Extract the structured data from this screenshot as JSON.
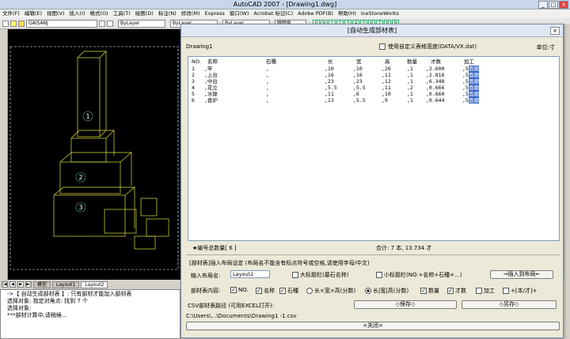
{
  "app": {
    "title": "AutoCAD 2007 - [Drawing1.dwg]"
  },
  "menu": [
    "文件(F)",
    "编辑(E)",
    "视图(V)",
    "插入(I)",
    "格式(O)",
    "工具(T)",
    "绘图(D)",
    "标注(N)",
    "修改(M)",
    "Express",
    "窗口(W)",
    "Acrobat 标记(C)",
    "Adobe PDF(B)",
    "帮助(H)",
    "IceStoneWorks"
  ],
  "toolbar": {
    "layer": "GAISANJ",
    "linetype1": "ByLayer",
    "linetype2": "ByLayer",
    "linetype3": "ByLayer",
    "color": "随颜色",
    "number_buttons": [
      "6",
      "N",
      "1",
      "2",
      "3",
      "4",
      "5",
      "6",
      "7",
      "8",
      "9"
    ]
  },
  "tabs": [
    "模型",
    "Layout1",
    "Layout2"
  ],
  "command_lines": [
    "->【 自动生成部材表 】: 只有部材才能加入部材表",
    "选择对象: 指定对角点: 找到 7 个",
    "选择对象:",
    "***部材计算中,请稍候..."
  ],
  "drawing_labels": [
    "1",
    "2",
    "3"
  ],
  "dialog": {
    "title": "[自动生成部材表]",
    "drawing_name": "Drawing1",
    "custom_table_label": "使用自定义表格宽度(DATA/VX.dat)",
    "unit": "单位:寸",
    "columns": [
      "NO.",
      "名称",
      "石種",
      "长",
      "宽",
      "高",
      "数量",
      "才数",
      "加工"
    ],
    "rows": [
      [
        "1",
        ",竿",
        ",",
        ",10",
        ",10",
        ",26",
        ",1",
        ",2.600",
        ",5"
      ],
      [
        "2",
        ",上台",
        ",",
        ",16",
        ",16",
        ",11",
        ",1",
        ",2.816",
        ",5"
      ],
      [
        "3",
        ",中台",
        ",",
        ",23",
        ",23",
        ",12",
        ",1",
        ",6.348",
        ",5"
      ],
      [
        "4",
        ",花立",
        ",",
        ",5.5",
        ",5.5",
        ",11",
        ",2",
        ",0.666",
        ",5"
      ],
      [
        "5",
        ",水鉢",
        ",",
        ",11",
        ",6",
        ",10",
        ",1",
        ",0.660",
        ",5"
      ],
      [
        "6",
        ",香炉",
        ",",
        ",13",
        ",5.5",
        ",9",
        ",1",
        ",0.644",
        ",5"
      ]
    ],
    "gong_marks": [
      "面磨",
      "面磨",
      "面磨",
      "面磨",
      "面磨",
      "面磨"
    ],
    "total_count": "★编号总数量[ 6 ]",
    "total_sum": "合计: 7 本, 13.734 才",
    "layout_section_title": "[部材表]插入布局设定 (布局名不能含有标点符号或空格,请使用字母/中文)",
    "layout_label": "输入布局名:",
    "layout_value": "Layout2",
    "big_header": "大标题栏(墓石名称)",
    "small_header": "小标题栏(NO.+名称+石種+...)",
    "insert_button": "→插入到布局←",
    "content_label": "部材表内容:",
    "options": [
      "NO.",
      "名称",
      "石種",
      "长×宽×高(分数)",
      "长|宽|高(分数)",
      "数量",
      "才数",
      "加工",
      "+[本/才]+"
    ],
    "csv_label": "CSV部材表路径 (可用EXCEL打开):",
    "save_button": "◇保存◇",
    "save_as_button": "◇另存◇",
    "csv_path": "C:\\Users\\...\\Documents\\Drawing1 -1.csv",
    "close_button": "×关闭×"
  }
}
